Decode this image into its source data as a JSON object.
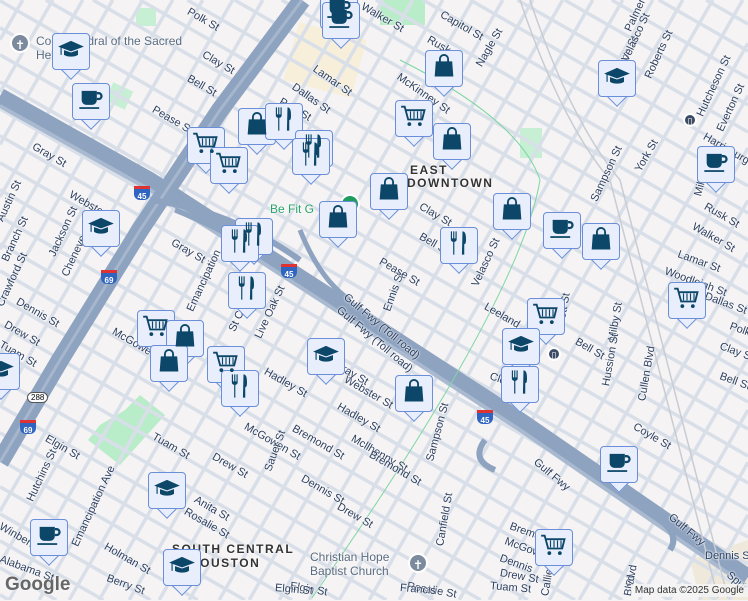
{
  "map": {
    "areas": {
      "east_downtown": [
        "EAST",
        "DOWNTOWN"
      ],
      "south_central": [
        "SOUTH CENTRAL",
        "HOUSTON"
      ]
    },
    "places": {
      "cathedral": "Co-Cathedral of the Sacred Heart",
      "be_fit": "Be Fit G",
      "church": [
        "Christian Hope",
        "Baptist Church"
      ]
    },
    "streets": [
      "Polk St",
      "Lamar St",
      "Dallas St",
      "Polk St",
      "Clay St",
      "Bell St",
      "Pease St",
      "Gray St",
      "Gray St",
      "Webster St",
      "Jackson St",
      "Cheneve",
      "Austin St",
      "Branch St",
      "Crawford St",
      "Dennis St",
      "Drew St",
      "Tuam St",
      "McGowen St",
      "Emancipation",
      "St Charles",
      "Live Oak St",
      "Hadley St",
      "McGowen St",
      "Tuam St",
      "Drew St",
      "Anita St",
      "Rosalie St",
      "Elgin St",
      "Hutchins St",
      "Emancipation Ave",
      "Winbern",
      "Alabama St",
      "Holman St",
      "Berry St",
      "Elgin St",
      "Bremond St",
      "Mcllhenny St",
      "Bremond St",
      "Dennis St",
      "Drew St",
      "Sauer St",
      "Sampson St",
      "Canfield St",
      "Rosalie St",
      "Gulf Fwy (Toll road)",
      "Gulf Fwy (Toll road)",
      "Gulf Fwy",
      "Ennis St",
      "Pease St",
      "Bell St",
      "Clay St",
      "Velasco St",
      "McKinney St",
      "Rusk St",
      "Capitol St",
      "Nagle St",
      "Walker St",
      "Leeland",
      "Scott St",
      "Bell St",
      "Milby St",
      "Hussion St",
      "Coyle St",
      "Cullen Blvd",
      "Sampson St",
      "York St",
      "Sampson St",
      "Roberts St",
      "Velasco St",
      "Palmer St",
      "Hutcheson St",
      "Everton St",
      "Harrisburg",
      "Milby",
      "Rusk St",
      "Walker St",
      "Lamar St",
      "Woodleigh St",
      "Dallas St",
      "Polk",
      "Clay St",
      "Bell St",
      "Bremond St",
      "McGowen",
      "Dennis",
      "Drew St",
      "Tuam St",
      "Callie",
      "Blvd",
      "Spur",
      "Gulf Fwy",
      "Webster St",
      "Gray St",
      "Cleburne",
      "Francis",
      "Elgin St",
      "Dennis St",
      "Blvd",
      "Hadley St"
    ],
    "highways": [
      "45",
      "45",
      "45",
      "69",
      "69",
      "288"
    ],
    "markers": [
      "coffee",
      "coffee",
      "school",
      "coffee",
      "cart",
      "cart",
      "bag",
      "restaurant",
      "restaurant",
      "restaurant",
      "bag",
      "bag",
      "cart",
      "bag",
      "bag",
      "bag",
      "restaurant",
      "coffee",
      "bag",
      "school",
      "coffee",
      "cart",
      "cart",
      "school",
      "restaurant",
      "bag",
      "coffee",
      "cart",
      "school",
      "restaurant",
      "restaurant",
      "restaurant",
      "school",
      "school",
      "cart",
      "bag",
      "bag",
      "cart",
      "restaurant",
      "school",
      "coffee",
      "school"
    ],
    "google_logo": "Google",
    "attribution": "Map data ©2025 Google",
    "colors": {
      "freeway": "#8ea3c0",
      "street": "#d7dde6",
      "park": "#b9ecc9",
      "marker_bg": "#e8eefc",
      "marker_border": "#6a8fd8",
      "icon": "#0c4668"
    }
  }
}
